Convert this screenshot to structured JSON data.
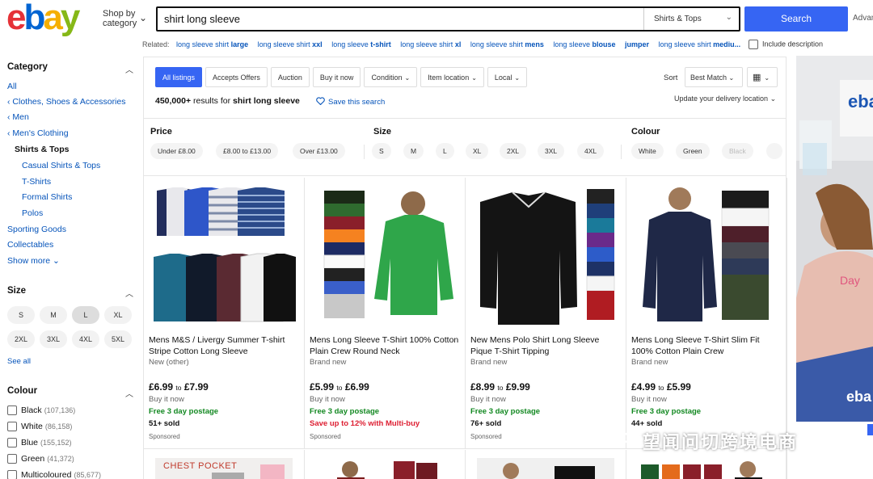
{
  "header": {
    "logo": [
      "e",
      "b",
      "a",
      "y"
    ],
    "shop_by": "Shop by category",
    "search_value": "shirt long sleeve",
    "search_category": "Shirts & Tops",
    "search_button": "Search",
    "advanced": "Advan"
  },
  "related": {
    "label": "Related:",
    "items": [
      {
        "pre": "long sleeve shirt ",
        "bold": "large"
      },
      {
        "pre": "long sleeve shirt ",
        "bold": "xxl"
      },
      {
        "pre": "long sleeve ",
        "bold": "t-shirt"
      },
      {
        "pre": "long sleeve shirt ",
        "bold": "xl"
      },
      {
        "pre": "long sleeve shirt ",
        "bold": "mens"
      },
      {
        "pre": "long sleeve ",
        "bold": "blouse"
      },
      {
        "pre": "",
        "bold": "jumper"
      },
      {
        "pre": "long sleeve shirt ",
        "bold": "mediu..."
      }
    ],
    "include_description": "Include description"
  },
  "sidebar": {
    "category_title": "Category",
    "category_links": [
      {
        "label": "All",
        "type": "link"
      },
      {
        "label": "‹ Clothes, Shoes & Accessories",
        "type": "link"
      },
      {
        "label": "‹ Men",
        "type": "link"
      },
      {
        "label": "‹ Men's Clothing",
        "type": "link"
      },
      {
        "label": "Shirts & Tops",
        "type": "current"
      },
      {
        "label": "Casual Shirts & Tops",
        "type": "sub"
      },
      {
        "label": "T-Shirts",
        "type": "sub"
      },
      {
        "label": "Formal Shirts",
        "type": "sub"
      },
      {
        "label": "Polos",
        "type": "sub"
      },
      {
        "label": "Sporting Goods",
        "type": "link"
      },
      {
        "label": "Collectables",
        "type": "link"
      },
      {
        "label": "Show more ⌄",
        "type": "link"
      }
    ],
    "size_title": "Size",
    "sizes": [
      "S",
      "M",
      "L",
      "XL",
      "2XL",
      "3XL",
      "4XL",
      "5XL"
    ],
    "selected_size": "L",
    "see_all": "See all",
    "colour_title": "Colour",
    "colours": [
      {
        "name": "Black",
        "count": "(107,136)"
      },
      {
        "name": "White",
        "count": "(86,158)"
      },
      {
        "name": "Blue",
        "count": "(155,152)"
      },
      {
        "name": "Green",
        "count": "(41,372)"
      },
      {
        "name": "Multicoloured",
        "count": "(85,677)"
      }
    ]
  },
  "toolbar": {
    "tabs": [
      {
        "label": "All listings",
        "active": true,
        "dropdown": false
      },
      {
        "label": "Accepts Offers",
        "active": false,
        "dropdown": false
      },
      {
        "label": "Auction",
        "active": false,
        "dropdown": false
      },
      {
        "label": "Buy it now",
        "active": false,
        "dropdown": false
      },
      {
        "label": "Condition",
        "active": false,
        "dropdown": true
      },
      {
        "label": "Item location",
        "active": false,
        "dropdown": true
      },
      {
        "label": "Local",
        "active": false,
        "dropdown": true
      }
    ],
    "results_count": "450,000+",
    "results_text": " results for ",
    "results_query": "shirt long sleeve",
    "save_search": "Save this search",
    "sort_label": "Sort",
    "sort_value": "Best Match",
    "delivery": "Update your delivery location"
  },
  "filters": {
    "price_title": "Price",
    "price_pills": [
      "Under £8.00",
      "£8.00 to £13.00",
      "Over £13.00"
    ],
    "size_title": "Size",
    "size_pills": [
      "S",
      "M",
      "L",
      "XL",
      "2XL",
      "3XL",
      "4XL"
    ],
    "colour_title": "Colour",
    "colour_pills": [
      "White",
      "Green",
      "Black"
    ]
  },
  "listings": [
    {
      "title": "Mens M&S / Livergy Summer T-shirt Stripe Cotton Long Sleeve",
      "condition": "New (other)",
      "price_low": "£6.99",
      "price_to": "to",
      "price_high": "£7.99",
      "buy": "Buy it now",
      "postage": "Free 3 day postage",
      "promo": "",
      "sold": "51+ sold",
      "sponsored": "Sponsored"
    },
    {
      "title": "Mens Long Sleeve T-Shirt 100% Cotton Plain Crew Round Neck",
      "condition": "Brand new",
      "price_low": "£5.99",
      "price_to": "to",
      "price_high": "£6.99",
      "buy": "Buy it now",
      "postage": "Free 3 day postage",
      "promo": "Save up to 12% with Multi-buy",
      "sold": "",
      "sponsored": "Sponsored"
    },
    {
      "title": "New Mens Polo Shirt Long Sleeve Pique T-Shirt Tipping",
      "condition": "Brand new",
      "price_low": "£8.99",
      "price_to": "to",
      "price_high": "£9.99",
      "buy": "Buy it now",
      "postage": "Free 3 day postage",
      "promo": "",
      "sold": "76+ sold",
      "sponsored": "Sponsored"
    },
    {
      "title": "Mens Long Sleeve T-Shirt Slim Fit 100% Cotton Plain Crew",
      "condition": "Brand new",
      "price_low": "£4.99",
      "price_to": "to",
      "price_high": "£5.99",
      "buy": "Buy it now",
      "postage": "Free 3 day postage",
      "promo": "",
      "sold": "44+ sold",
      "sponsored": ""
    }
  ],
  "row2": {
    "chest_pocket": "CHEST POCKET"
  },
  "ad": {
    "logo": "eba",
    "shirt_text": "Day",
    "bottom_logo": "eba"
  },
  "watermark": "望闻问切跨境电商",
  "colors": {
    "accent": "#3665f3",
    "link": "#0654ba",
    "postage": "#118820",
    "promo": "#dd1e31"
  }
}
